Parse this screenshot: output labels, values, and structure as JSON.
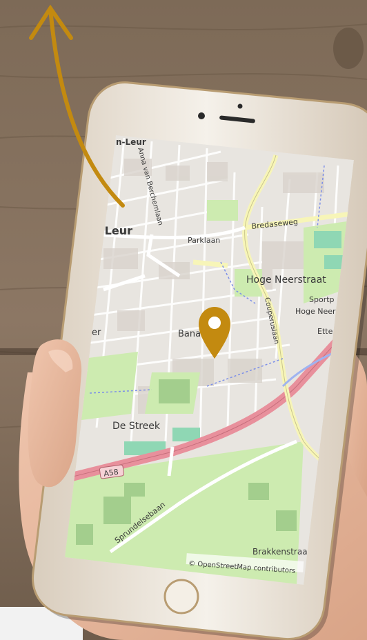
{
  "colors": {
    "accent": "#C38A10",
    "map_background": "#E8E5E0",
    "motorway": "#E8909C",
    "primary_road": "#F7F5B8",
    "park": "#CDEBB0",
    "water_blue": "#7C8FE8"
  },
  "map": {
    "labels": {
      "town_top": "n-Leur",
      "town_left": "-Leur",
      "street_anna": "Anna van Berchemlaan",
      "parklaan": "Parklaan",
      "bredaseweg": "Bredaseweg",
      "hoge_neerstraat": "Hoge Neerstraat",
      "sportpark": "Sportp",
      "hoge_neer": "Hoge Neer",
      "couperuslaan": "Couperuslaan",
      "ette": "Ette",
      "bana": "Bana",
      "er": "er",
      "de_streek": "De Streek",
      "a58": "A58",
      "sprundelsebaan": "Sprundelsebaan",
      "brakkenstraat": "Brakkenstraa"
    },
    "attribution": "© OpenStreetMap contributors",
    "pin_icon": "location-pin-icon"
  },
  "phone": {
    "home_button_icon": "home-button",
    "arrow_icon": "up-arrow-icon"
  }
}
